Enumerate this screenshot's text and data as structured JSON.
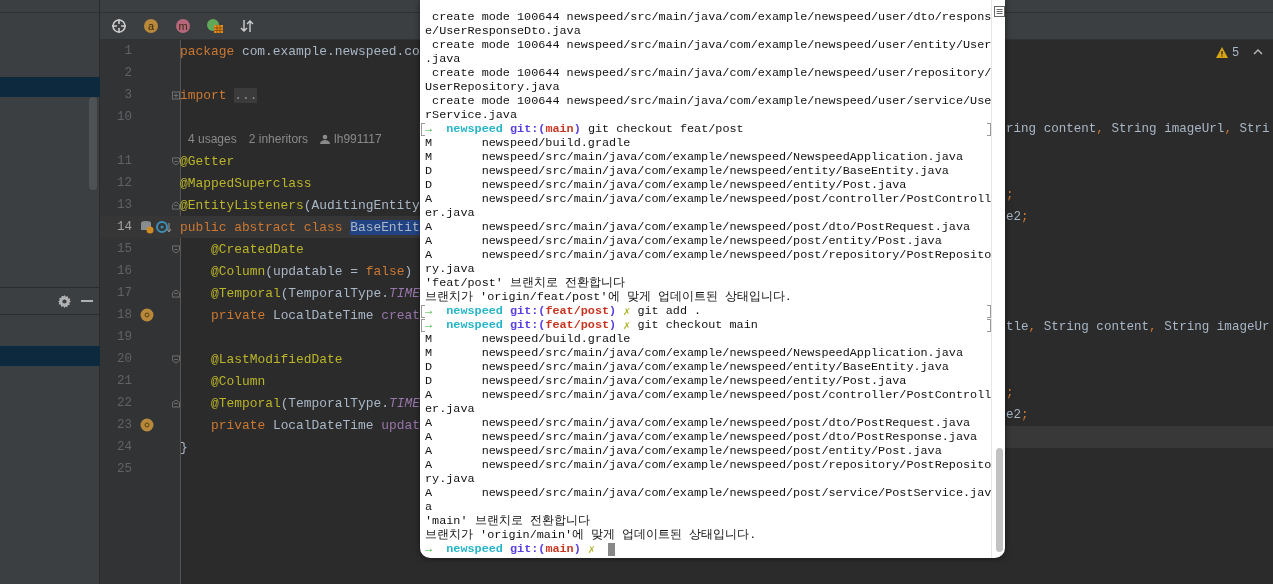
{
  "toolbar": [
    {
      "kind": "target"
    },
    {
      "kind": "letter",
      "letter": "a",
      "color": "#b8893a"
    },
    {
      "kind": "letter",
      "letter": "m",
      "color": "#b7677b"
    },
    {
      "kind": "table"
    },
    {
      "kind": "sort"
    }
  ],
  "editor": {
    "lines": [
      {
        "kind": "code",
        "number": "1",
        "segments": [
          {
            "kind": "keyword",
            "text": "package "
          },
          {
            "kind": "plain",
            "text": "com.example.newspeed.co"
          }
        ]
      },
      {
        "kind": "code",
        "number": "2"
      },
      {
        "kind": "code",
        "number": "3",
        "fold": {
          "kind": "collapsed"
        },
        "segments": [
          {
            "kind": "keyword",
            "text": "import "
          },
          {
            "kind": "folded",
            "text": "..."
          }
        ]
      },
      {
        "kind": "code",
        "number": "10"
      },
      {
        "kind": "lens",
        "usages": "4 usages",
        "inheritors": "2 inheritors",
        "author": "lh991117"
      },
      {
        "kind": "code",
        "number": "11",
        "fold": {
          "kind": "open"
        },
        "segments": [
          {
            "kind": "annotation",
            "text": "@Getter"
          }
        ]
      },
      {
        "kind": "code",
        "number": "12",
        "segments": [
          {
            "kind": "annotation",
            "text": "@MappedSuperclass"
          }
        ]
      },
      {
        "kind": "code",
        "number": "13",
        "fold": {
          "kind": "close"
        },
        "segments": [
          {
            "kind": "annotation",
            "text": "@EntityListeners"
          },
          {
            "kind": "plain",
            "text": "(AuditingEntity"
          }
        ]
      },
      {
        "kind": "code",
        "number": "14",
        "current": true,
        "gutter": [
          {
            "kind": "database"
          },
          {
            "kind": "implemented"
          }
        ],
        "segments": [
          {
            "kind": "keyword",
            "text": "public abstract class "
          },
          {
            "kind": "selected",
            "text": "BaseEntit"
          }
        ]
      },
      {
        "kind": "code",
        "number": "15",
        "indented": true,
        "fold": {
          "kind": "open"
        },
        "segments": [
          {
            "kind": "annotation",
            "text": "@CreatedDate"
          }
        ]
      },
      {
        "kind": "code",
        "number": "16",
        "indented": true,
        "segments": [
          {
            "kind": "annotation",
            "text": "@Column"
          },
          {
            "kind": "plain",
            "text": "(updatable = "
          },
          {
            "kind": "keyword",
            "text": "false"
          },
          {
            "kind": "plain",
            "text": ")"
          }
        ]
      },
      {
        "kind": "code",
        "number": "17",
        "indented": true,
        "fold": {
          "kind": "close"
        },
        "segments": [
          {
            "kind": "annotation",
            "text": "@Temporal"
          },
          {
            "kind": "plain",
            "text": "(TemporalType."
          },
          {
            "kind": "constant",
            "text": "TIME"
          }
        ]
      },
      {
        "kind": "code",
        "number": "18",
        "indented": true,
        "gutter": [
          {
            "kind": "field"
          }
        ],
        "segments": [
          {
            "kind": "keyword",
            "text": "private "
          },
          {
            "kind": "plain",
            "text": "LocalDateTime "
          },
          {
            "kind": "field",
            "text": "creat"
          }
        ]
      },
      {
        "kind": "code",
        "number": "19"
      },
      {
        "kind": "code",
        "number": "20",
        "indented": true,
        "fold": {
          "kind": "open"
        },
        "segments": [
          {
            "kind": "annotation",
            "text": "@LastModifiedDate"
          }
        ]
      },
      {
        "kind": "code",
        "number": "21",
        "indented": true,
        "segments": [
          {
            "kind": "annotation",
            "text": "@Column"
          }
        ]
      },
      {
        "kind": "code",
        "number": "22",
        "indented": true,
        "fold": {
          "kind": "close"
        },
        "segments": [
          {
            "kind": "annotation",
            "text": "@Temporal"
          },
          {
            "kind": "plain",
            "text": "(TemporalType."
          },
          {
            "kind": "constant",
            "text": "TIME"
          }
        ]
      },
      {
        "kind": "code",
        "number": "23",
        "indented": true,
        "gutter": [
          {
            "kind": "field"
          }
        ],
        "segments": [
          {
            "kind": "keyword",
            "text": "private "
          },
          {
            "kind": "plain",
            "text": "LocalDateTime "
          },
          {
            "kind": "field",
            "text": "updat"
          }
        ]
      },
      {
        "kind": "code",
        "number": "24",
        "segments": [
          {
            "kind": "plain",
            "text": "}"
          }
        ]
      },
      {
        "kind": "code",
        "number": "25"
      }
    ]
  },
  "split_editor": {
    "warnings": "5",
    "rows": [
      {
        "current": false
      },
      {
        "current": false
      },
      {
        "current": false,
        "segments": [
          {
            "kind": "plain",
            "text": "ring content"
          },
          {
            "kind": "keyword",
            "text": ","
          },
          {
            "kind": "plain",
            "text": " String imageUrl"
          },
          {
            "kind": "keyword",
            "text": ","
          },
          {
            "kind": "plain",
            "text": " Stri"
          }
        ]
      },
      {
        "current": false
      },
      {
        "current": false
      },
      {
        "current": false,
        "segments": [
          {
            "kind": "keyword",
            "text": ";"
          }
        ]
      },
      {
        "current": false,
        "segments": [
          {
            "kind": "plain",
            "text": "e2"
          },
          {
            "kind": "keyword",
            "text": ";"
          }
        ]
      },
      {
        "current": false
      },
      {
        "current": false
      },
      {
        "current": false
      },
      {
        "current": false
      },
      {
        "current": false,
        "segments": [
          {
            "kind": "plain",
            "text": "tle"
          },
          {
            "kind": "keyword",
            "text": ","
          },
          {
            "kind": "plain",
            "text": " String content"
          },
          {
            "kind": "keyword",
            "text": ","
          },
          {
            "kind": "plain",
            "text": " String imageUr"
          }
        ]
      },
      {
        "current": false
      },
      {
        "current": false
      },
      {
        "current": false,
        "segments": [
          {
            "kind": "keyword",
            "text": ";"
          }
        ]
      },
      {
        "current": false,
        "segments": [
          {
            "kind": "plain",
            "text": "e2"
          },
          {
            "kind": "keyword",
            "text": ";"
          }
        ]
      },
      {
        "current": true
      }
    ]
  },
  "terminal": {
    "lines": [
      {
        "kind": "output",
        "text": " create mode 100644 newspeed/src/main/java/com/example/newspeed/user/dto/respons"
      },
      {
        "kind": "output",
        "text": "e/UserResponseDto.java"
      },
      {
        "kind": "output",
        "text": " create mode 100644 newspeed/src/main/java/com/example/newspeed/user/entity/User"
      },
      {
        "kind": "output",
        "text": ".java"
      },
      {
        "kind": "output",
        "text": " create mode 100644 newspeed/src/main/java/com/example/newspeed/user/repository/"
      },
      {
        "kind": "output",
        "text": "UserRepository.java"
      },
      {
        "kind": "output",
        "text": " create mode 100644 newspeed/src/main/java/com/example/newspeed/user/service/Use"
      },
      {
        "kind": "output",
        "text": "rService.java"
      },
      {
        "kind": "prompt",
        "marked": true,
        "arrow": "→",
        "dir": "newspeed",
        "git": "git:(",
        "branch": "main",
        "git_close": ")",
        "command": "git checkout feat/post"
      },
      {
        "kind": "file",
        "status": "M",
        "path": "newspeed/build.gradle"
      },
      {
        "kind": "file",
        "status": "M",
        "path": "newspeed/src/main/java/com/example/newspeed/NewspeedApplication.java"
      },
      {
        "kind": "file",
        "status": "D",
        "path": "newspeed/src/main/java/com/example/newspeed/entity/BaseEntity.java"
      },
      {
        "kind": "file",
        "status": "D",
        "path": "newspeed/src/main/java/com/example/newspeed/entity/Post.java"
      },
      {
        "kind": "file",
        "status": "A",
        "path": "newspeed/src/main/java/com/example/newspeed/post/controller/PostControll"
      },
      {
        "kind": "output",
        "text": "er.java"
      },
      {
        "kind": "file",
        "status": "A",
        "path": "newspeed/src/main/java/com/example/newspeed/post/dto/PostRequest.java"
      },
      {
        "kind": "file",
        "status": "A",
        "path": "newspeed/src/main/java/com/example/newspeed/post/entity/Post.java"
      },
      {
        "kind": "file",
        "status": "A",
        "path": "newspeed/src/main/java/com/example/newspeed/post/repository/PostReposito"
      },
      {
        "kind": "output",
        "text": "ry.java"
      },
      {
        "kind": "output",
        "text": "'feat/post' 브랜치로 전환합니다"
      },
      {
        "kind": "output",
        "text": "브랜치가 'origin/feat/post'에 맞게 업데이트된 상태입니다."
      },
      {
        "kind": "prompt",
        "marked": true,
        "arrow": "→",
        "dir": "newspeed",
        "git": "git:(",
        "branch": "feat/post",
        "git_close": ")",
        "dirty": "✗",
        "command": "git add ."
      },
      {
        "kind": "prompt",
        "marked": true,
        "arrow": "→",
        "dir": "newspeed",
        "git": "git:(",
        "branch": "feat/post",
        "git_close": ")",
        "dirty": "✗",
        "command": "git checkout main"
      },
      {
        "kind": "file",
        "status": "M",
        "path": "newspeed/build.gradle"
      },
      {
        "kind": "file",
        "status": "M",
        "path": "newspeed/src/main/java/com/example/newspeed/NewspeedApplication.java"
      },
      {
        "kind": "file",
        "status": "D",
        "path": "newspeed/src/main/java/com/example/newspeed/entity/BaseEntity.java"
      },
      {
        "kind": "file",
        "status": "D",
        "path": "newspeed/src/main/java/com/example/newspeed/entity/Post.java"
      },
      {
        "kind": "file",
        "status": "A",
        "path": "newspeed/src/main/java/com/example/newspeed/post/controller/PostControll"
      },
      {
        "kind": "output",
        "text": "er.java"
      },
      {
        "kind": "file",
        "status": "A",
        "path": "newspeed/src/main/java/com/example/newspeed/post/dto/PostRequest.java"
      },
      {
        "kind": "file",
        "status": "A",
        "path": "newspeed/src/main/java/com/example/newspeed/post/dto/PostResponse.java"
      },
      {
        "kind": "file",
        "status": "A",
        "path": "newspeed/src/main/java/com/example/newspeed/post/entity/Post.java"
      },
      {
        "kind": "file",
        "status": "A",
        "path": "newspeed/src/main/java/com/example/newspeed/post/repository/PostReposito"
      },
      {
        "kind": "output",
        "text": "ry.java"
      },
      {
        "kind": "file",
        "status": "A",
        "path": "newspeed/src/main/java/com/example/newspeed/post/service/PostService.jav"
      },
      {
        "kind": "output",
        "text": "a"
      },
      {
        "kind": "output",
        "text": "'main' 브랜치로 전환합니다"
      },
      {
        "kind": "output",
        "text": "브랜치가 'origin/main'에 맞게 업데이트된 상태입니다."
      },
      {
        "kind": "prompt",
        "marked": false,
        "cursor": true,
        "arrow": "→",
        "dir": "newspeed",
        "git": "git:(",
        "branch": "main",
        "git_close": ")",
        "dirty": "✗"
      }
    ]
  }
}
